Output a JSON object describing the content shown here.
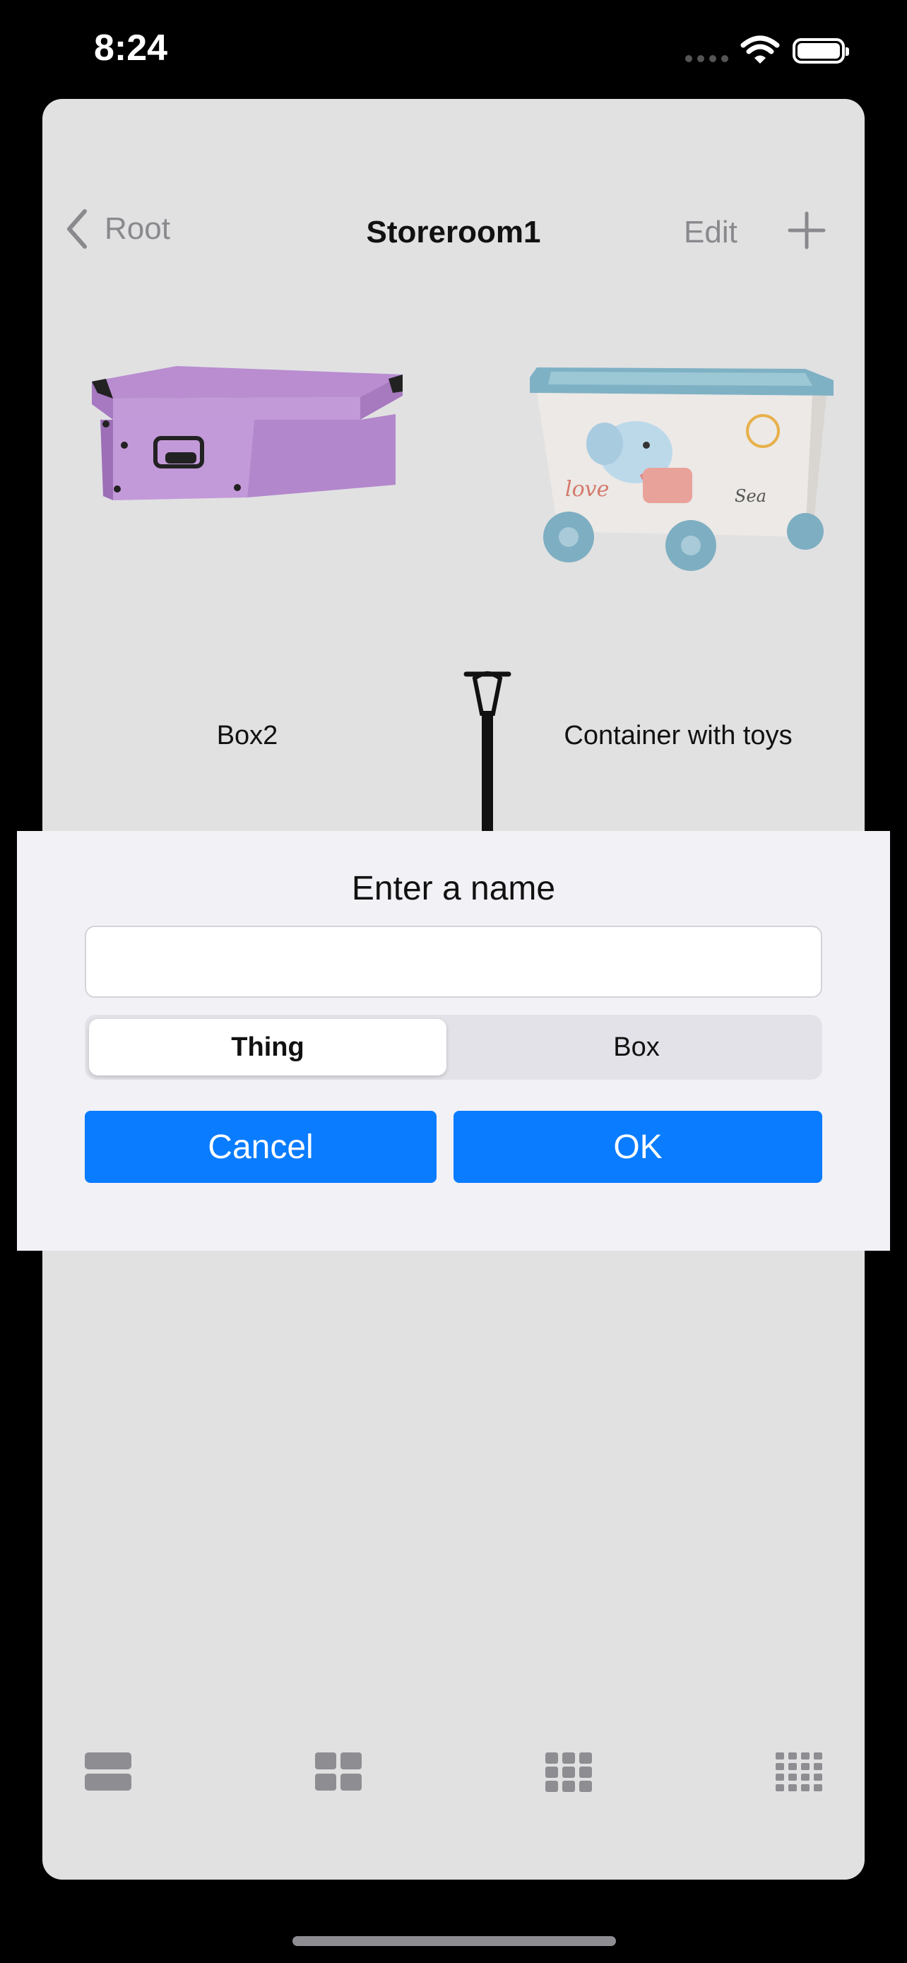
{
  "status_bar": {
    "time": "8:24",
    "icons": [
      "cellular-signal-icon",
      "wifi-icon",
      "battery-icon"
    ]
  },
  "nav": {
    "back_label": "Root",
    "title": "Storeroom1",
    "edit_label": "Edit",
    "add_icon": "plus-icon"
  },
  "items": [
    {
      "name": "Box2",
      "icon": "purple-storage-box-image"
    },
    {
      "name": "Container with toys",
      "icon": "toy-container-image"
    },
    {
      "name": "",
      "icon": "shovel-image"
    }
  ],
  "dialog": {
    "title": "Enter a name",
    "name_value": "",
    "segments": [
      "Thing",
      "Box"
    ],
    "selected_segment": "Thing",
    "cancel_label": "Cancel",
    "ok_label": "OK"
  },
  "toolbar": {
    "icons": [
      "list-layout-icon",
      "grid-2-layout-icon",
      "grid-3-layout-icon",
      "grid-4-layout-icon"
    ]
  },
  "colors": {
    "accent": "#0a7cff",
    "sheet_background": "#e1e1e2",
    "dialog_background": "#f1f1f6",
    "inactive": "#8a8a8e"
  }
}
